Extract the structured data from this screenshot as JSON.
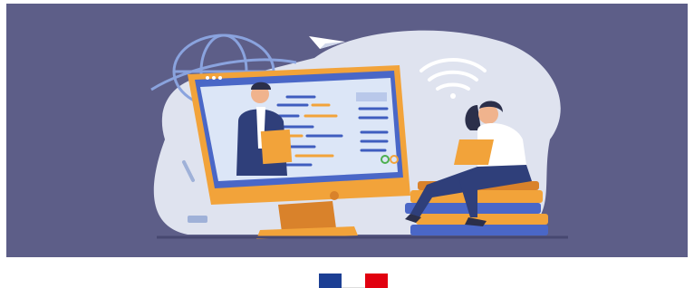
{
  "colors": {
    "banner_background": "#5d5e88",
    "blob": "#dfe3ef",
    "monitor_frame": "#f2a33a",
    "monitor_dark": "#d9822b",
    "screen": "#4a67c7",
    "screen_inner": "#dce6f7",
    "text_lines_blue": "#3f5dbf",
    "text_lines_orange": "#f2a33a",
    "man_suit": "#2f3f7a",
    "woman_pants": "#2f3f7a",
    "books_orange": "#f2a33a",
    "books_blue": "#4a67c7",
    "flag_blue": "#1c3f94",
    "flag_white": "#ffffff",
    "flag_red": "#e1000f"
  },
  "icons": [
    "globe-icon",
    "paper-plane-icon",
    "wifi-icon",
    "paperclip-icon",
    "usb-icon",
    "check-icon"
  ],
  "footer": {
    "emblem": "french-republic-flag-logo"
  }
}
